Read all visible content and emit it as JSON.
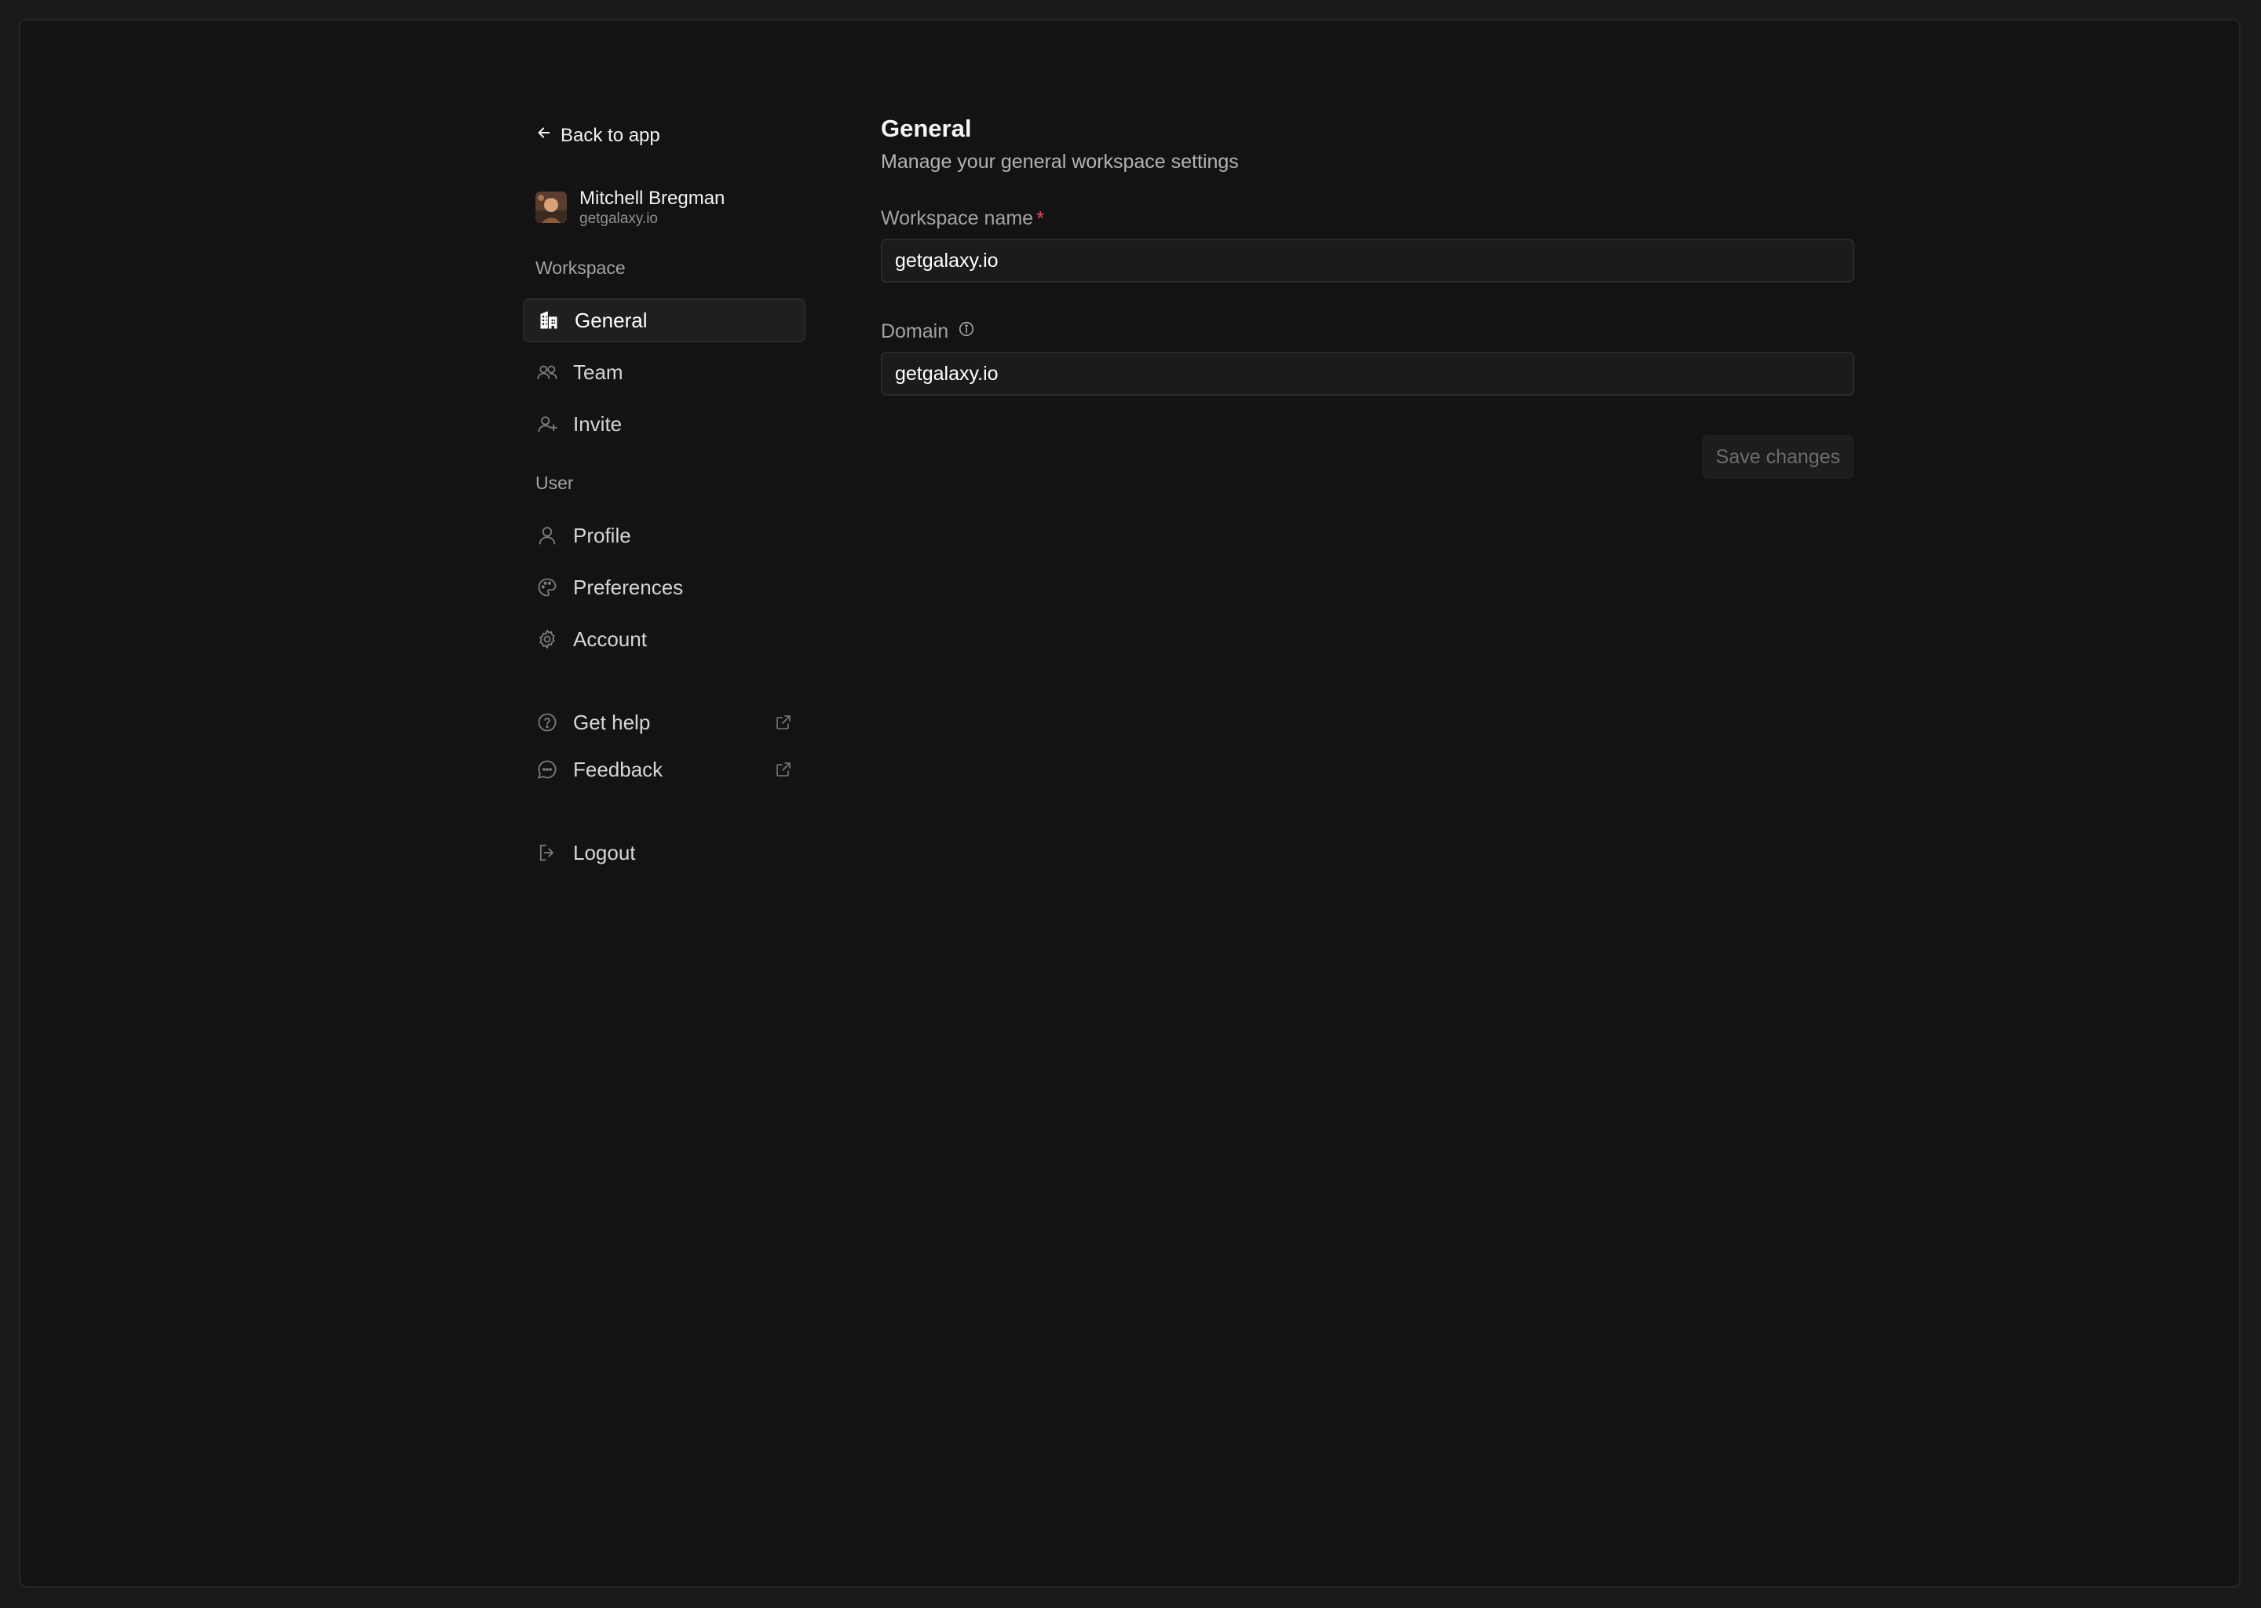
{
  "sidebar": {
    "back_label": "Back to app",
    "user": {
      "name": "Mitchell Bregman",
      "domain": "getgalaxy.io"
    },
    "workspace_label": "Workspace",
    "workspace_items": [
      {
        "label": "General",
        "icon": "building-icon",
        "active": true
      },
      {
        "label": "Team",
        "icon": "users-icon"
      },
      {
        "label": "Invite",
        "icon": "user-plus-icon"
      }
    ],
    "user_label": "User",
    "user_items": [
      {
        "label": "Profile",
        "icon": "user-icon"
      },
      {
        "label": "Preferences",
        "icon": "palette-icon"
      },
      {
        "label": "Account",
        "icon": "gear-icon"
      }
    ],
    "help_items": [
      {
        "label": "Get help",
        "icon": "help-circle-icon",
        "external": true
      },
      {
        "label": "Feedback",
        "icon": "chat-bubble-icon",
        "external": true
      }
    ],
    "logout_label": "Logout"
  },
  "main": {
    "title": "General",
    "subtitle": "Manage your general workspace settings",
    "workspace_name": {
      "label": "Workspace name",
      "required_mark": "*",
      "value": "getgalaxy.io"
    },
    "domain": {
      "label": "Domain",
      "value": "getgalaxy.io"
    },
    "save_label": "Save changes"
  },
  "colors": {
    "background": "#131313",
    "outer": "#1a1a1a",
    "active_bg": "#1f1f1f",
    "required": "#e5484d",
    "muted_text": "#a3a3a3"
  }
}
